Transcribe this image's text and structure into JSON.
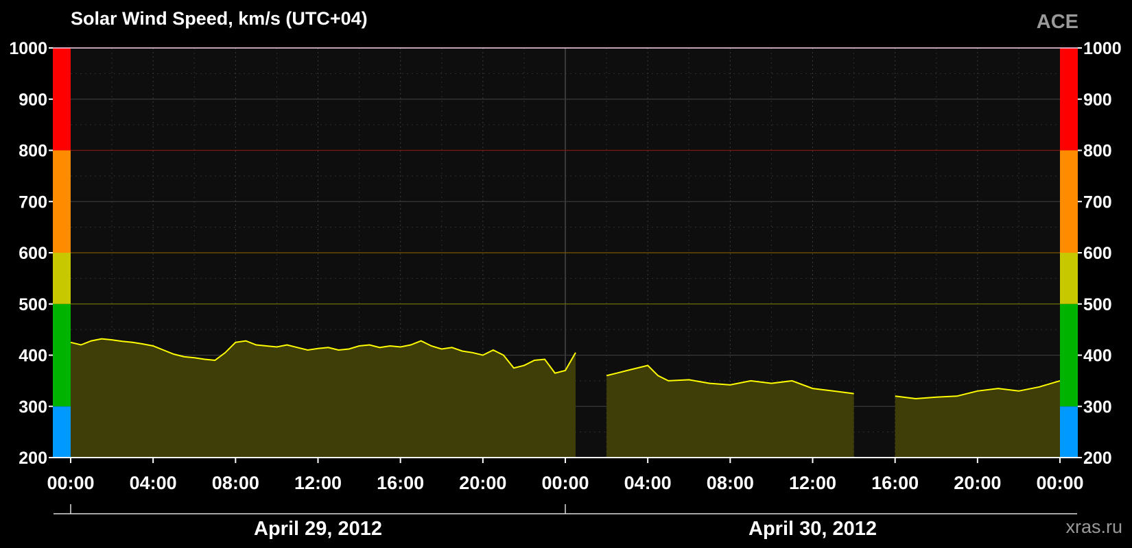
{
  "header": {
    "title": "Solar Wind Speed, km/s (UTC+04)",
    "source_label": "ACE"
  },
  "footer": {
    "credit": "xras.ru"
  },
  "colors": {
    "background": "#000000",
    "plot_background": "#0e0e0e",
    "series_line": "#ffff00",
    "series_fill": "#3f3d08",
    "band_blue": "#0099ff",
    "band_green": "#00b300",
    "band_yellow": "#c8c800",
    "band_orange": "#ff8c00",
    "band_red": "#ff0000"
  },
  "chart_data": {
    "type": "area",
    "title": "Solar Wind Speed, km/s (UTC+04)",
    "ylim": [
      200,
      1000
    ],
    "yticks": [
      200,
      300,
      400,
      500,
      600,
      700,
      800,
      900,
      1000
    ],
    "x_range_hours": [
      0,
      48
    ],
    "xtick_labels": [
      "00:00",
      "04:00",
      "08:00",
      "12:00",
      "16:00",
      "20:00",
      "00:00",
      "04:00",
      "08:00",
      "12:00",
      "16:00",
      "20:00",
      "00:00"
    ],
    "day_labels": [
      "April 29, 2012",
      "April 30, 2012"
    ],
    "grid": true,
    "threshold_lines": [
      {
        "value": 500,
        "color": "#6e6e00"
      },
      {
        "value": 600,
        "color": "#7a5a00"
      },
      {
        "value": 800,
        "color": "#7a1a10"
      }
    ],
    "activity_bands": [
      {
        "from": 200,
        "to": 300,
        "color": "#0099ff"
      },
      {
        "from": 300,
        "to": 500,
        "color": "#00b300"
      },
      {
        "from": 500,
        "to": 600,
        "color": "#c8c800"
      },
      {
        "from": 600,
        "to": 800,
        "color": "#ff8c00"
      },
      {
        "from": 800,
        "to": 1000,
        "color": "#ff0000"
      }
    ],
    "series": [
      {
        "x_hours": [
          0,
          0.5,
          1,
          1.5,
          2,
          2.5,
          3,
          3.5,
          4,
          4.5,
          5,
          5.5,
          6,
          6.5,
          7,
          7.5,
          8,
          8.5,
          9,
          9.5,
          10,
          10.5,
          11,
          11.5,
          12,
          12.5,
          13,
          13.5,
          14,
          14.5,
          15,
          15.5,
          16,
          16.5,
          17,
          17.5,
          18,
          18.5,
          19,
          19.5,
          20,
          20.5,
          21,
          21.5,
          22,
          22.5,
          23,
          23.5,
          24,
          24.5,
          25,
          26,
          26.5,
          27,
          28,
          28.5,
          29,
          30,
          31,
          32,
          33,
          34,
          35,
          36,
          37,
          38,
          39,
          40,
          41,
          42,
          43,
          44,
          45,
          46,
          47,
          48
        ],
        "values": [
          425,
          420,
          428,
          432,
          430,
          427,
          425,
          422,
          418,
          410,
          402,
          397,
          395,
          392,
          390,
          405,
          425,
          428,
          420,
          418,
          416,
          420,
          415,
          410,
          413,
          415,
          410,
          412,
          418,
          420,
          415,
          418,
          416,
          420,
          428,
          418,
          412,
          415,
          408,
          405,
          400,
          410,
          400,
          375,
          380,
          390,
          392,
          365,
          370,
          405,
          350,
          360,
          365,
          370,
          380,
          360,
          350,
          352,
          345,
          342,
          350,
          345,
          350,
          335,
          330,
          325,
          322,
          320,
          315,
          318,
          320,
          330,
          335,
          330,
          338,
          350
        ]
      }
    ],
    "data_gaps_hours": [
      [
        24.8,
        25.5
      ],
      [
        38.5,
        39.8
      ]
    ]
  }
}
